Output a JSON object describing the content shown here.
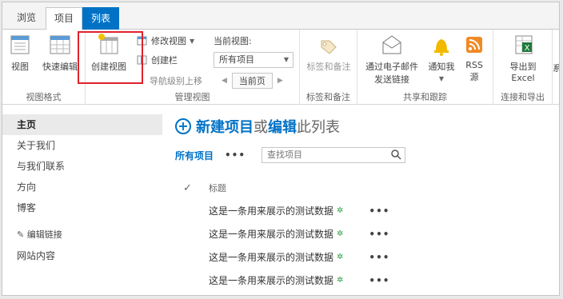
{
  "tabs": [
    "浏览",
    "项目",
    "列表"
  ],
  "ribbon": {
    "view": {
      "label": "视图"
    },
    "quick_edit": {
      "label": "快速编辑"
    },
    "group_view_format": "视图格式",
    "create_view": {
      "label": "创建视图"
    },
    "modify_view": "修改视图",
    "create_column": "创建栏",
    "nav_up": "导航级别上移",
    "current_view_label": "当前视图:",
    "current_view_value": "所有项目",
    "current_page": "当前页",
    "group_manage_views": "管理视图",
    "tags_notes": "标签和备注",
    "group_tags_notes": "标签和备注",
    "email_link": "通过电子邮件\n发送链接",
    "email_link_l1": "通过电子邮件",
    "email_link_l2": "发送链接",
    "alert_me": "通知我",
    "rss_l1": "RSS",
    "rss_l2": "源",
    "group_share_track": "共享和跟踪",
    "export_l1": "导出到",
    "export_l2": "Excel",
    "group_connect_export": "连接和导出",
    "cut_right": "系"
  },
  "leftnav": {
    "items": [
      "主页",
      "关于我们",
      "与我们联系",
      "方向",
      "博客"
    ],
    "edit_links": "编辑链接",
    "site_contents": "网站内容"
  },
  "main": {
    "new_item": "新建项目",
    "or": "或",
    "edit": "编辑",
    "this_list": "此列表",
    "view_name": "所有项目",
    "more": "•••",
    "search_placeholder": "查找项目",
    "check_mark": "✓",
    "column_title": "标题",
    "rows": [
      "这是一条用来展示的测试数据",
      "这是一条用来展示的测试数据",
      "这是一条用来展示的测试数据",
      "这是一条用来展示的测试数据"
    ],
    "new_marker": "✲",
    "row_more": "•••"
  },
  "colors": {
    "accent": "#0072c6",
    "highlight": "#e0222a"
  },
  "icons": [
    "view-icon",
    "quick-edit-icon",
    "create-view-icon",
    "modify-view-icon",
    "create-column-icon",
    "nav-up-icon",
    "tags-icon",
    "email-icon",
    "bell-icon",
    "rss-icon",
    "excel-icon",
    "search-icon",
    "pencil-icon"
  ]
}
